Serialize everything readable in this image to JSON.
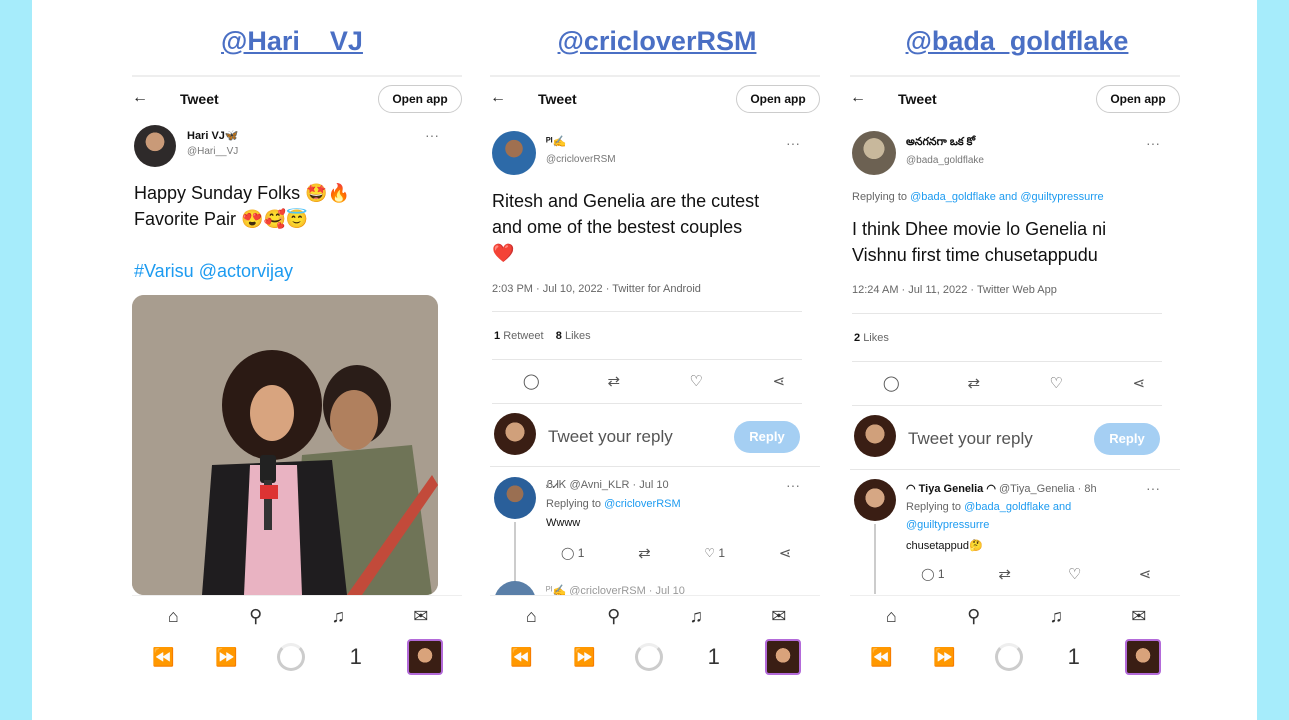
{
  "columns": [
    {
      "title": "@Hari__VJ",
      "topbar": {
        "title": "Tweet",
        "open_app": "Open app"
      },
      "author": {
        "name": "Hari VJ🦋",
        "handle": "@Hari__VJ"
      },
      "tweet_line1": "Happy Sunday Folks 🤩🔥",
      "tweet_line2": "Favorite Pair 😍🥰😇",
      "hashtags": "#Varisu @actorvijay"
    },
    {
      "title": "@cricloverRSM",
      "topbar": {
        "title": "Tweet",
        "open_app": "Open app"
      },
      "author": {
        "name": "ᴾᴵ✍️",
        "handle": "@cricloverRSM"
      },
      "tweet_line1": "Ritesh and Genelia are the cutest",
      "tweet_line2": "and  ome of the bestest couples",
      "tweet_line3": "❤️",
      "meta": "2:03 PM · Jul 10, 2022 · Twitter for Android",
      "counts": {
        "retweets": "1",
        "retweets_label": "Retweet",
        "likes": "8",
        "likes_label": "Likes"
      },
      "reply_placeholder": "Tweet your reply",
      "reply_button": "Reply",
      "reply": {
        "header": "ᏰᏗᏦ @Avni_KLR · Jul 10",
        "replying_prefix": "Replying to ",
        "replying_to": "@cricloverRSM",
        "text": "Wwww",
        "reply_count": "1",
        "like_count": "1"
      },
      "next_reply_header": "ᴾᴵ✍️ @cricloverRSM · Jul 10"
    },
    {
      "title": "@bada_goldflake",
      "topbar": {
        "title": "Tweet",
        "open_app": "Open app"
      },
      "author": {
        "name": "అనగనగా ఒక కో️",
        "handle": "@bada_goldflake"
      },
      "replying_prefix": "Replying to ",
      "replying_to": "@bada_goldflake and @guiltypressurre",
      "tweet_line1": "I think Dhee movie lo Genelia ni",
      "tweet_line2": "Vishnu first time chusetappudu",
      "meta": "12:24 AM · Jul 11, 2022 · Twitter Web App",
      "counts": {
        "likes": "2",
        "likes_label": "Likes"
      },
      "reply_placeholder": "Tweet your reply",
      "reply_button": "Reply",
      "reply": {
        "header_name": "◠ Tiya Genelia ◠",
        "header_rest": "@Tiya_Genelia · 8h",
        "replying_prefix": "Replying to ",
        "replying_line1": "@bada_goldflake and",
        "replying_line2": "@guiltypressurre",
        "text": "chusetappud🤔",
        "reply_count": "1"
      }
    }
  ],
  "browser": {
    "tab_count": "1"
  },
  "icons": {
    "back": "arrow-left-icon",
    "more": "more-dots-icon",
    "reply": "comment-icon",
    "retweet": "retweet-icon",
    "like": "heart-icon",
    "share": "share-icon",
    "home": "home-icon",
    "search": "search-icon",
    "notifications": "bell-icon",
    "messages": "mail-icon",
    "browser_back": "rewind-icon",
    "browser_forward": "forward-icon"
  },
  "colors": {
    "background": "#a6ecfb",
    "title_link": "#4a6fc4",
    "twitter_blue": "#1d9bf0",
    "reply_button": "#a5cff3"
  }
}
